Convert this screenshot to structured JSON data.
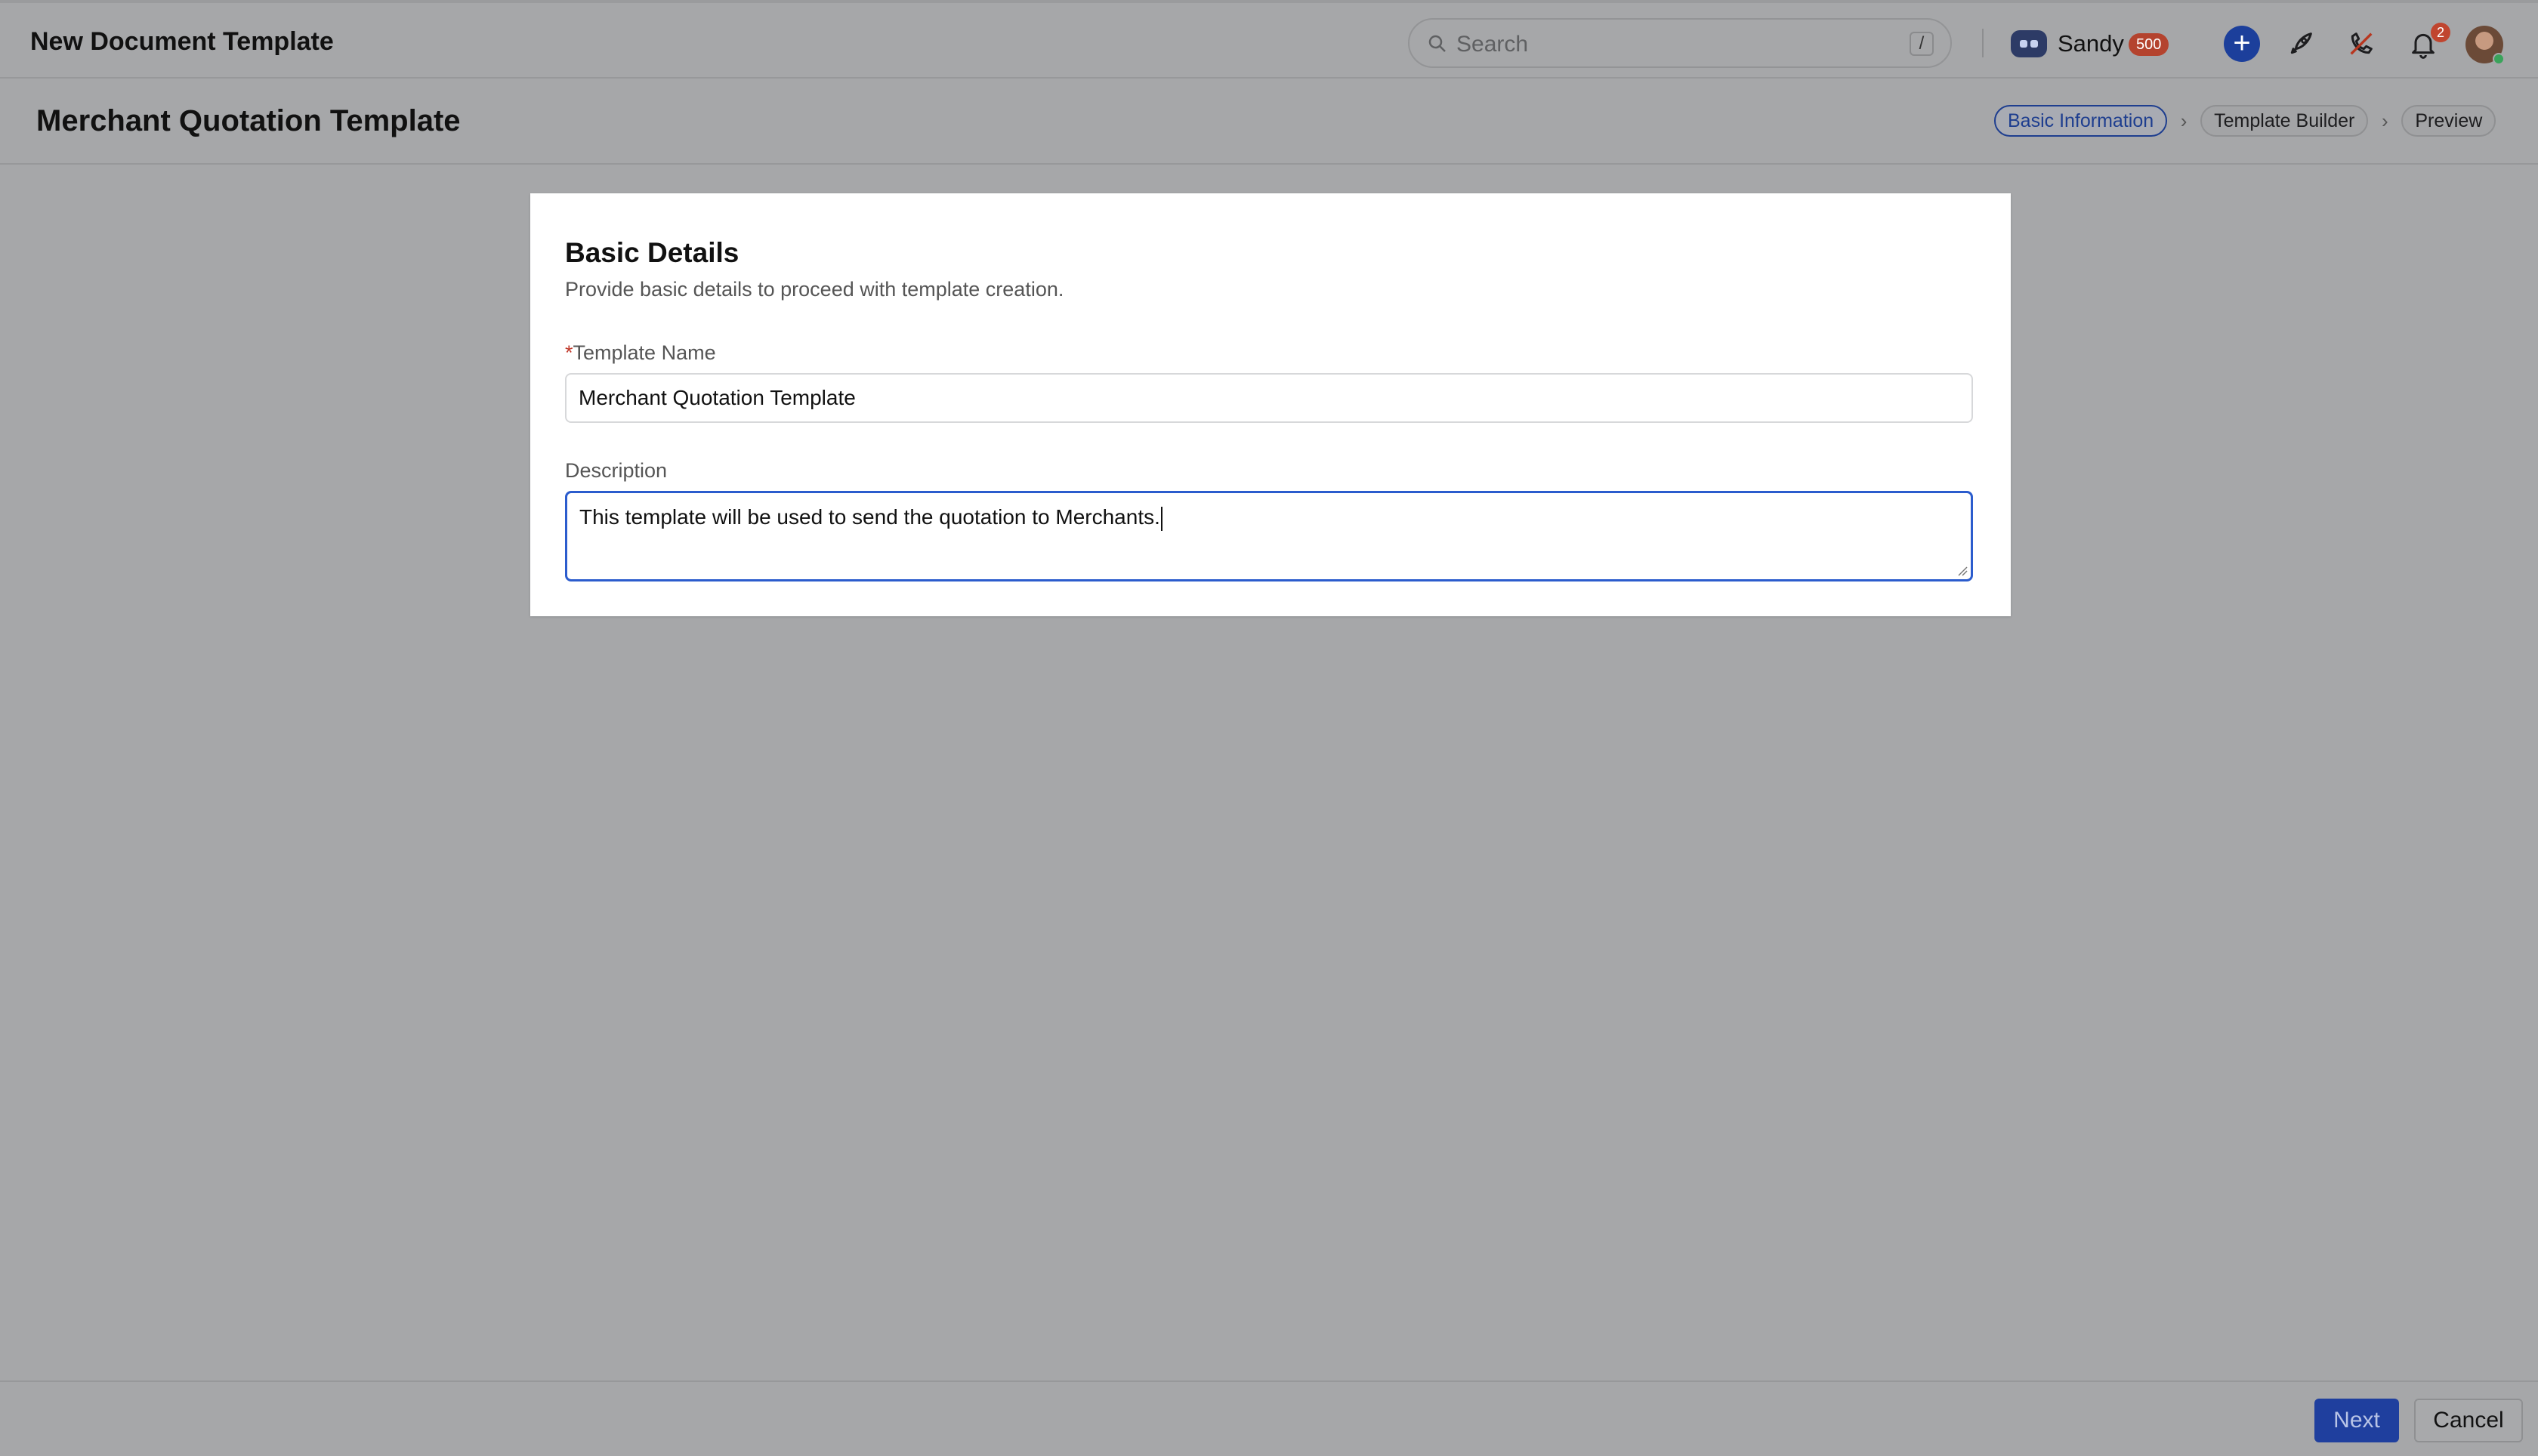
{
  "topbar": {
    "app_title": "New Document Template",
    "search": {
      "placeholder": "Search",
      "shortcut": "/"
    },
    "user": {
      "name": "Sandy",
      "points": "500"
    },
    "notifications_count": "2"
  },
  "header": {
    "title": "Merchant Quotation Template",
    "steps": [
      {
        "label": "Basic Information",
        "active": true
      },
      {
        "label": "Template Builder",
        "active": false
      },
      {
        "label": "Preview",
        "active": false
      }
    ]
  },
  "form": {
    "heading": "Basic Details",
    "subheading": "Provide basic details to proceed with template creation.",
    "template_name": {
      "required_marker": "*",
      "label": "Template Name",
      "value": "Merchant Quotation Template"
    },
    "description": {
      "label": "Description",
      "value": "This template will be used to send the quotation to Merchants."
    }
  },
  "footer": {
    "next_label": "Next",
    "cancel_label": "Cancel"
  },
  "colors": {
    "accent": "#1f3f9e",
    "overlay": "#a6a7a9",
    "badge": "#c0452f"
  }
}
